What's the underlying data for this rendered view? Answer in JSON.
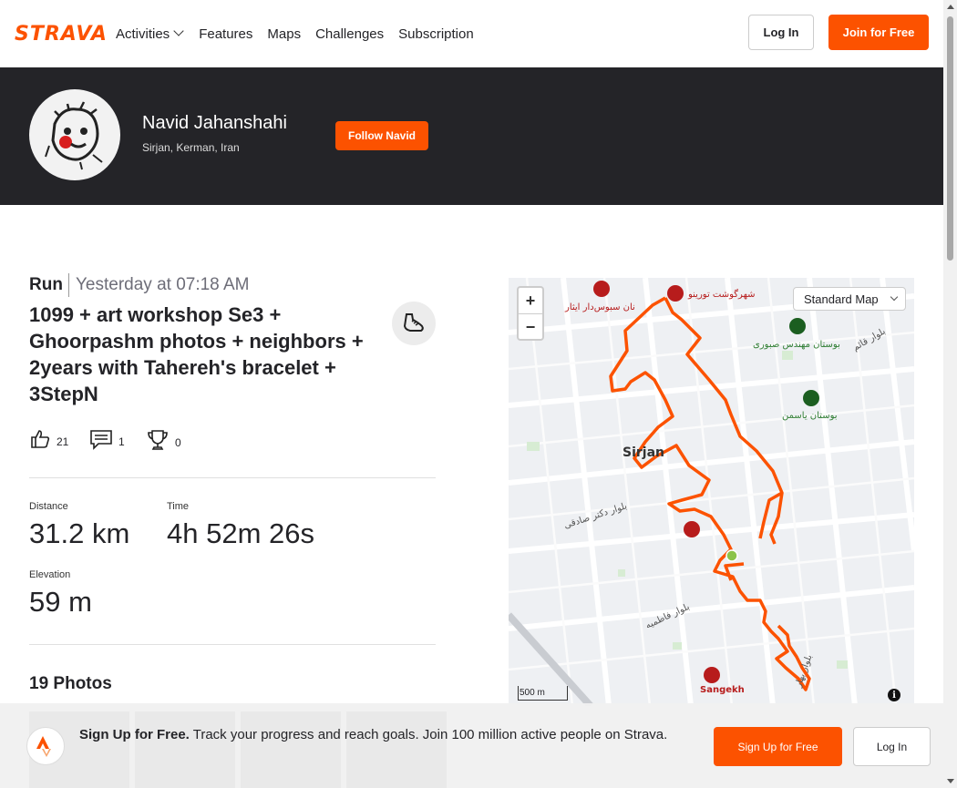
{
  "nav": {
    "logo": "STRAVA",
    "links": [
      "Activities",
      "Features",
      "Maps",
      "Challenges",
      "Subscription"
    ],
    "login_label": "Log In",
    "join_label": "Join for Free"
  },
  "athlete": {
    "name": "Navid Jahanshahi",
    "location": "Sirjan, Kerman, Iran",
    "follow_label": "Follow Navid"
  },
  "activity": {
    "type": "Run",
    "time": "Yesterday at 07:18 AM",
    "title": "1099 + art workshop Se3 + Ghoorpashm photos + neighbors + 2years with Tahereh's bracelet + 3StepN",
    "kudos": "21",
    "comments": "1",
    "achievements": "0",
    "stats": {
      "distance_label": "Distance",
      "distance": "31.2 km",
      "time_label": "Time",
      "time": "4h 52m 26s",
      "elevation_label": "Elevation",
      "elevation": "59 m"
    },
    "photos_title": "19 Photos"
  },
  "map": {
    "zoom_in": "+",
    "zoom_out": "−",
    "style_label": "Standard Map",
    "scale": "500 m",
    "info": "i",
    "city_label": "Sirjan",
    "place_sangekh": "Sangekh",
    "places_fa": [
      "شهرگوشت تورینو",
      "نان سبوس‌دار ایثار",
      "بوستان مهندس صبوری",
      "بوستان یاسمن",
      "بلوار دکتر صادقی",
      "بلوار فاطمیه",
      "بلوار قائم",
      "بلوار بهار"
    ]
  },
  "banner": {
    "lead": "Sign Up for Free.",
    "text": " Track your progress and reach goals. Join 100 million active people on Strava.",
    "signup_label": "Sign Up for Free",
    "login_label": "Log In"
  },
  "colors": {
    "brand": "#fc5200",
    "band": "#242428"
  }
}
